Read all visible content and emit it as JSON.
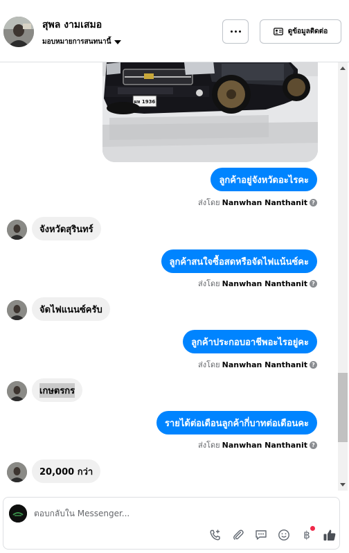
{
  "header": {
    "name": "สุพล งามเสมอ",
    "assign_label": "มอบหมายการสนทนานี้",
    "contact_label": "ดูข้อมูลติดต่อ"
  },
  "icons": {
    "more": "more-dots-icon",
    "contact": "contact-card-icon",
    "call": "phone-plus-icon",
    "attach": "paperclip-icon",
    "saved_replies": "chat-bubble-icon",
    "emoji": "smiley-icon",
    "payment": "baht-icon",
    "like": "thumbs-up-icon"
  },
  "colors": {
    "accent": "#0084ff",
    "incoming_bubble": "#f0f0f0",
    "muted_text": "#65676b",
    "notification": "#f02849"
  },
  "messages": [
    {
      "direction": "out",
      "text": "ลูกค้าอยู่จังหวัดอะไรคะ",
      "sent_by_prefix": "ส่งโดย",
      "sent_by_name": "Nanwhan Nanthanit"
    },
    {
      "direction": "in",
      "text": "จังหวัดสุรินทร์"
    },
    {
      "direction": "out",
      "text": "ลูกค้าสนใจซื้อสดหรือจัดไฟแน้นซ์คะ",
      "sent_by_prefix": "ส่งโดย",
      "sent_by_name": "Nanwhan Nanthanit"
    },
    {
      "direction": "in",
      "text": "จัดไฟแนนซ์ครับ"
    },
    {
      "direction": "out",
      "text": "ลูกค้าประกอบอาชีพอะไรอยู่คะ",
      "sent_by_prefix": "ส่งโดย",
      "sent_by_name": "Nanwhan Nanthanit"
    },
    {
      "direction": "in",
      "text": "เกษตรกร"
    },
    {
      "direction": "out",
      "text": "รายได้ต่อเดือนลูกค้ากี่บาทต่อเดือนคะ",
      "sent_by_prefix": "ส่งโดย",
      "sent_by_name": "Nanwhan Nanthanit"
    },
    {
      "direction": "in",
      "text": "20,000 กว่า"
    }
  ],
  "photo": {
    "plate": "ผห 1936"
  },
  "composer": {
    "placeholder": "ตอบกลับใน Messenger..."
  }
}
